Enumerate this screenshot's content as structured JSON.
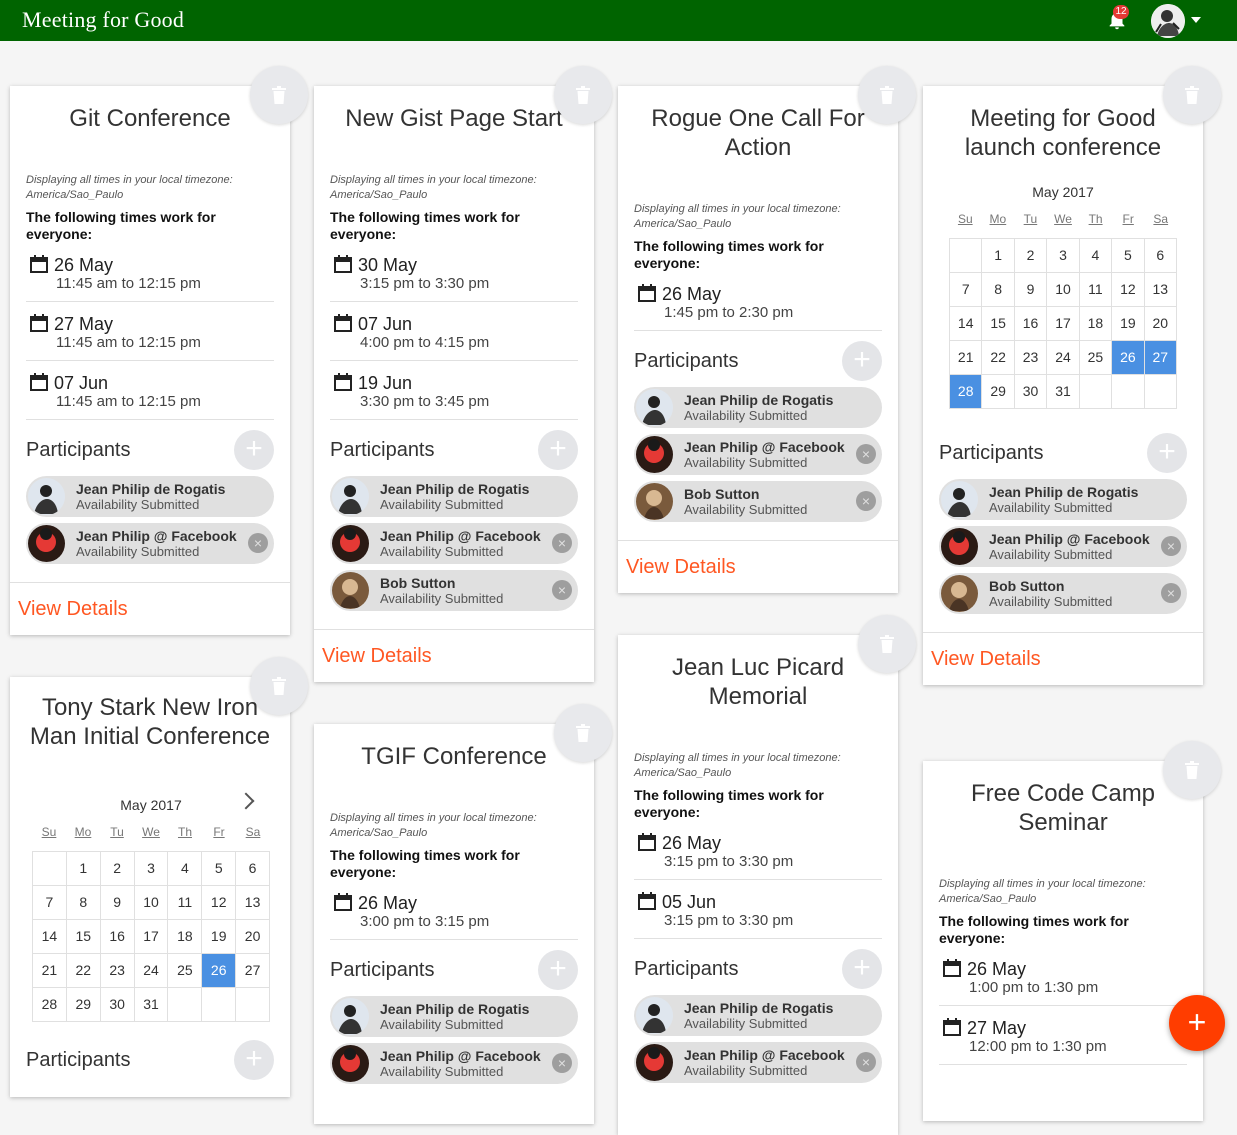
{
  "app": {
    "title": "Meeting for Good",
    "notification_count": "12"
  },
  "common": {
    "tz_note": "Displaying all times in your local timezone: America/Sao_Paulo",
    "work_header": "The following times work for everyone:",
    "participants_label": "Participants",
    "view_details": "View Details",
    "availability": "Availability Submitted",
    "add": "+",
    "remove": "×",
    "fab": "+"
  },
  "calendar_common": {
    "month": "May 2017",
    "dow": [
      "Su",
      "Mo",
      "Tu",
      "We",
      "Th",
      "Fr",
      "Sa"
    ]
  },
  "cards": [
    {
      "title": "Git Conference",
      "slots": [
        {
          "date": "26 May",
          "time": "11:45 am to 12:15 pm"
        },
        {
          "date": "27 May",
          "time": "11:45 am to 12:15 pm"
        },
        {
          "date": "07 Jun",
          "time": "11:45 am to 12:15 pm"
        }
      ],
      "participants": [
        {
          "name": "Jean Philip de Rogatis",
          "status": "Availability Submitted",
          "removable": false
        },
        {
          "name": "Jean Philip @ Facebook",
          "status": "Availability Submitted",
          "removable": true
        }
      ]
    },
    {
      "title": "New Gist Page Start",
      "slots": [
        {
          "date": "30 May",
          "time": "3:15 pm to 3:30 pm"
        },
        {
          "date": "07 Jun",
          "time": "4:00 pm to 4:15 pm"
        },
        {
          "date": "19 Jun",
          "time": "3:30 pm to 3:45 pm"
        }
      ],
      "participants": [
        {
          "name": "Jean Philip de Rogatis",
          "status": "Availability Submitted",
          "removable": false
        },
        {
          "name": "Jean Philip @ Facebook",
          "status": "Availability Submitted",
          "removable": true
        },
        {
          "name": "Bob Sutton",
          "status": "Availability Submitted",
          "removable": true
        }
      ]
    },
    {
      "title": "Rogue One Call For Action",
      "slots": [
        {
          "date": "26 May",
          "time": "1:45 pm to 2:30 pm"
        }
      ],
      "participants": [
        {
          "name": "Jean Philip de Rogatis",
          "status": "Availability Submitted",
          "removable": false
        },
        {
          "name": "Jean Philip @ Facebook",
          "status": "Availability Submitted",
          "removable": true
        },
        {
          "name": "Bob Sutton",
          "status": "Availability Submitted",
          "removable": true
        }
      ]
    },
    {
      "title": "Meeting for Good launch conference",
      "calendar_selected": [
        "26",
        "27",
        "28"
      ],
      "participants": [
        {
          "name": "Jean Philip de Rogatis",
          "status": "Availability Submitted",
          "removable": false
        },
        {
          "name": "Jean Philip @ Facebook",
          "status": "Availability Submitted",
          "removable": true
        },
        {
          "name": "Bob Sutton",
          "status": "Availability Submitted",
          "removable": true
        }
      ]
    },
    {
      "title": "Tony Stark New Iron Man Initial Conference",
      "calendar_selected": [
        "26"
      ]
    },
    {
      "title": "TGIF Conference",
      "slots": [
        {
          "date": "26 May",
          "time": "3:00 pm to 3:15 pm"
        }
      ],
      "participants": [
        {
          "name": "Jean Philip de Rogatis",
          "status": "Availability Submitted",
          "removable": false
        },
        {
          "name": "Jean Philip @ Facebook",
          "status": "Availability Submitted",
          "removable": true
        }
      ]
    },
    {
      "title": "Jean Luc Picard Memorial",
      "slots": [
        {
          "date": "26 May",
          "time": "3:15 pm to 3:30 pm"
        },
        {
          "date": "05 Jun",
          "time": "3:15 pm to 3:30 pm"
        }
      ],
      "participants": [
        {
          "name": "Jean Philip de Rogatis",
          "status": "Availability Submitted",
          "removable": false
        },
        {
          "name": "Jean Philip @ Facebook",
          "status": "Availability Submitted",
          "removable": true
        }
      ]
    },
    {
      "title": "Free Code Camp Seminar",
      "slots": [
        {
          "date": "26 May",
          "time": "1:00 pm to 1:30 pm"
        },
        {
          "date": "27 May",
          "time": "12:00 pm to 1:30 pm"
        }
      ]
    }
  ],
  "colors": {
    "topbar": "#006400",
    "accent": "#ff5722",
    "calendar_selected": "#4a90e2",
    "fab": "#ff3d00"
  }
}
